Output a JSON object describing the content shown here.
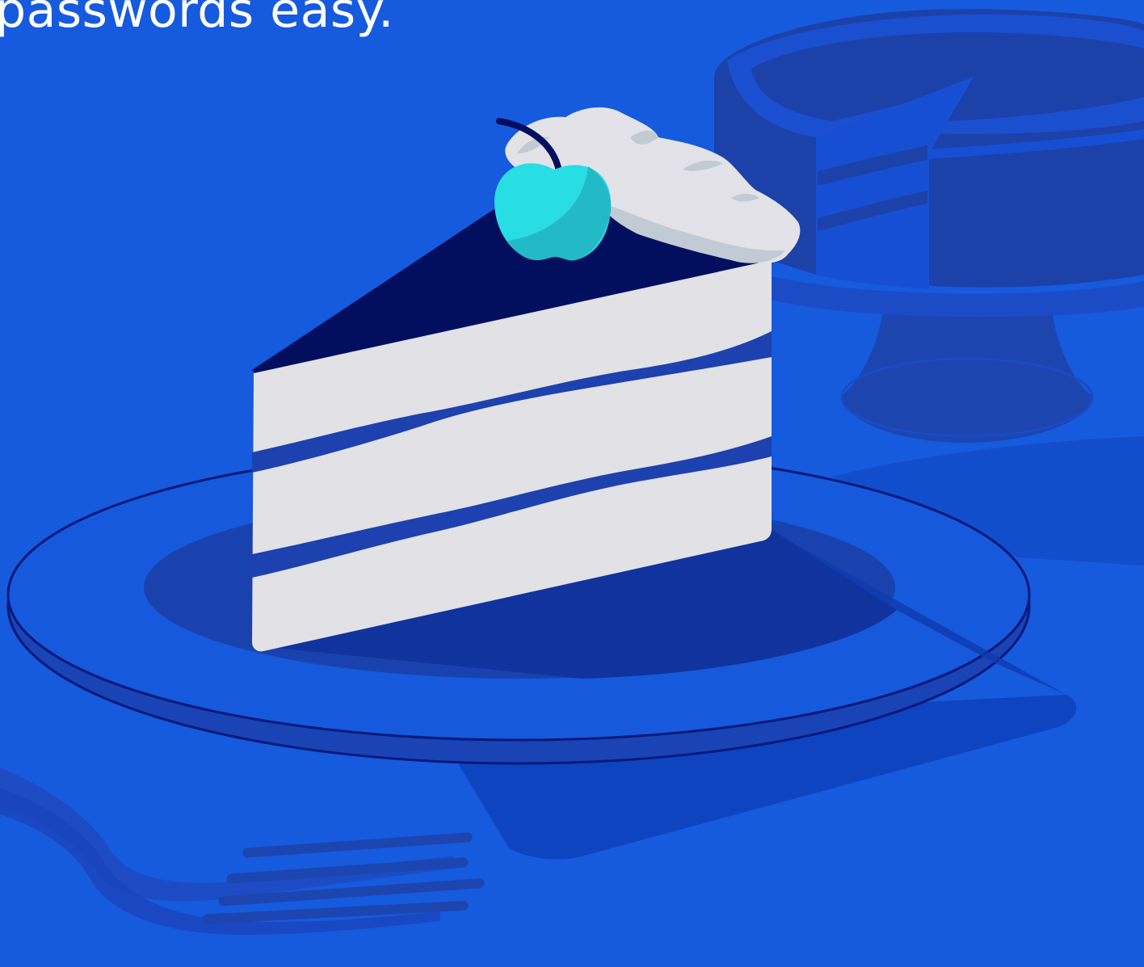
{
  "hero": {
    "headline": "passwords easy."
  },
  "illustration": {
    "subject": "cake-slice-on-plate",
    "icons": [
      "cake-slice-icon",
      "cherry-icon",
      "whipped-cream-icon",
      "plate-icon",
      "fork-icon",
      "whole-cake-icon",
      "cake-stand-icon"
    ]
  },
  "colors": {
    "background": "#165ADE",
    "navy": "#020F5E",
    "frosting": "#E1E1E6",
    "filling": "#1D41AE",
    "cherry": "#29DDE5",
    "shadow": "#0F3AA8"
  }
}
